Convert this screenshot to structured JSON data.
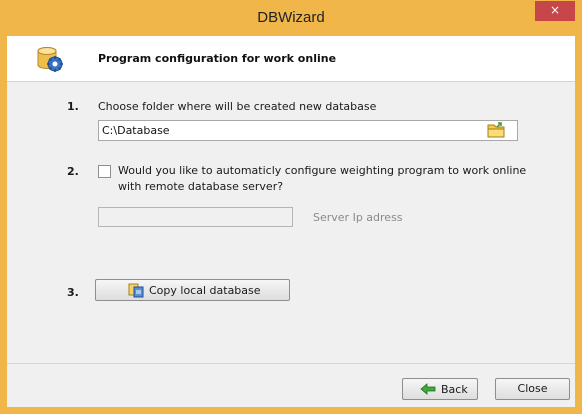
{
  "window": {
    "title": "DBWizard",
    "close_glyph": "×"
  },
  "header": {
    "title": "Program configuration for work online",
    "icon": "database-gear-icon"
  },
  "step1": {
    "number": "1.",
    "label": "Choose folder where will be created new database",
    "folder_value": "C:\\Database"
  },
  "step2": {
    "number": "2.",
    "label_line1": "Would you like to automaticly configure weighting program to work online",
    "label_line2": "with remote database server?",
    "checked": false,
    "ip_value": "",
    "ip_label": "Server Ip adress"
  },
  "step3": {
    "number": "3.",
    "button_label": "Copy local database"
  },
  "footer": {
    "back_label": "Back",
    "close_label": "Close"
  },
  "colors": {
    "titlebar": "#f0b64a",
    "close": "#c7464a"
  }
}
